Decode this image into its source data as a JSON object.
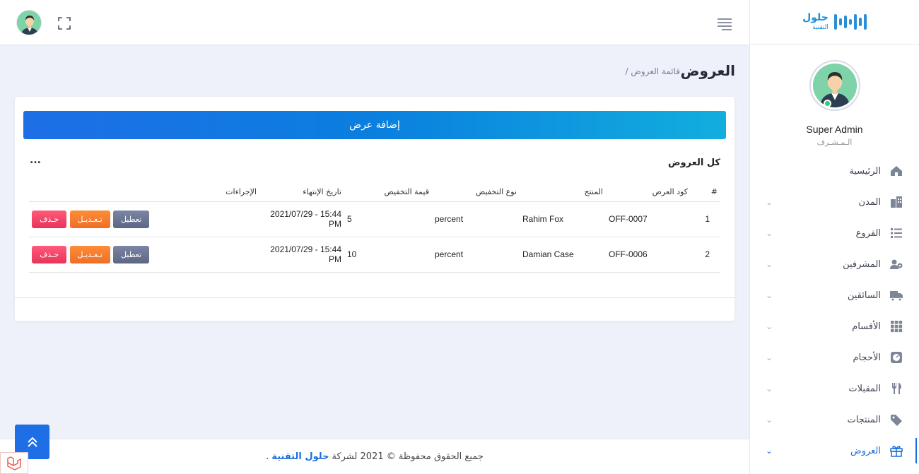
{
  "brand": {
    "name": "حلول",
    "sub": "التقنية"
  },
  "profile": {
    "name": "Super Admin",
    "role": "الـمـشـرف"
  },
  "menu": [
    {
      "label": "الرئيسية",
      "icon": "home-icon",
      "chevron": false
    },
    {
      "label": "المدن",
      "icon": "city-icon",
      "chevron": true
    },
    {
      "label": "الفروع",
      "icon": "list-icon",
      "chevron": true
    },
    {
      "label": "المشرفين",
      "icon": "users-gear-icon",
      "chevron": true
    },
    {
      "label": "السائقين",
      "icon": "truck-icon",
      "chevron": true
    },
    {
      "label": "الأقسام",
      "icon": "grid-icon",
      "chevron": true
    },
    {
      "label": "الأحجام",
      "icon": "scale-icon",
      "chevron": true
    },
    {
      "label": "المقبلات",
      "icon": "utensils-icon",
      "chevron": true
    },
    {
      "label": "المنتجات",
      "icon": "tags-icon",
      "chevron": true
    },
    {
      "label": "العروض",
      "icon": "gift-icon",
      "chevron": true,
      "active": true
    }
  ],
  "page": {
    "title": "العروض",
    "breadcrumb": "/ قائمة العروض"
  },
  "card": {
    "add_label": "إضافة عرض",
    "title": "كل العروض",
    "menu_dots": "..."
  },
  "table": {
    "headers": [
      "#",
      "كود العرض",
      "المنتج",
      "نوع التخفيض",
      "قيمة التخفيض",
      "تاريخ الإنتهاء",
      "الإجراءات"
    ],
    "rows": [
      {
        "index": "1",
        "code": "OFF-0007",
        "product": "Rahim Fox",
        "type": "percent",
        "value": "5",
        "expires": "2021/07/29 - 15:44 PM"
      },
      {
        "index": "2",
        "code": "OFF-0006",
        "product": "Damian Case",
        "type": "percent",
        "value": "10",
        "expires": "2021/07/29 - 15:44 PM"
      }
    ],
    "actions": {
      "disable": "تعطيل",
      "edit": "تـعـديـل",
      "delete": "حـذف"
    }
  },
  "footer": {
    "prefix": "جميع الحقوق محفوظة © 2021 لشركة",
    "brand": "حلول التقنية",
    "suffix": "."
  },
  "colors": {
    "accent": "#1e6ee6",
    "edit": "#ee6f27",
    "delete": "#e8345a",
    "disable": "#5c6685"
  }
}
